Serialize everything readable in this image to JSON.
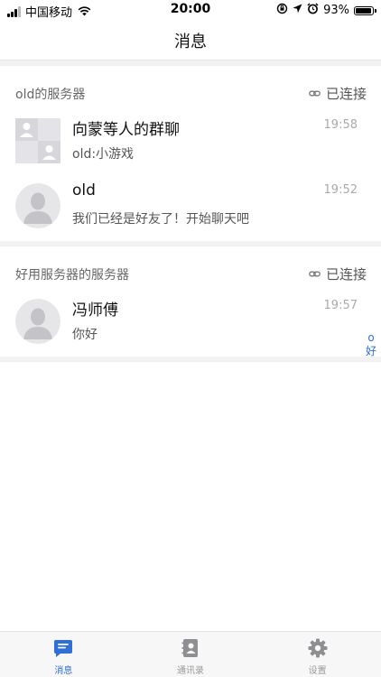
{
  "status_bar": {
    "carrier": "中国移动",
    "time": "20:00",
    "battery": "93%",
    "battery_level": 0.93
  },
  "nav": {
    "title": "消息"
  },
  "groups": [
    {
      "name": "old的服务器",
      "status": "已连接",
      "chats": [
        {
          "name": "向蒙等人的群聊",
          "message": "old:小游戏",
          "time": "19:58",
          "avatar": "group-avatar"
        },
        {
          "name": "old",
          "message": "我们已经是好友了！开始聊天吧",
          "time": "19:52",
          "avatar": "person-avatar"
        }
      ]
    },
    {
      "name": "好用服务器的服务器",
      "status": "已连接",
      "chats": [
        {
          "name": "冯师傅",
          "message": "你好",
          "time": "19:57",
          "avatar": "person-avatar"
        }
      ]
    }
  ],
  "side_index": [
    "o",
    "好"
  ],
  "tabs": [
    {
      "label": "消息",
      "icon": "chat-icon",
      "active": true
    },
    {
      "label": "通讯录",
      "icon": "contacts-icon",
      "active": false
    },
    {
      "label": "设置",
      "icon": "gear-icon",
      "active": false
    }
  ],
  "colors": {
    "accent": "#2f6fd6",
    "inactive": "#999999"
  }
}
